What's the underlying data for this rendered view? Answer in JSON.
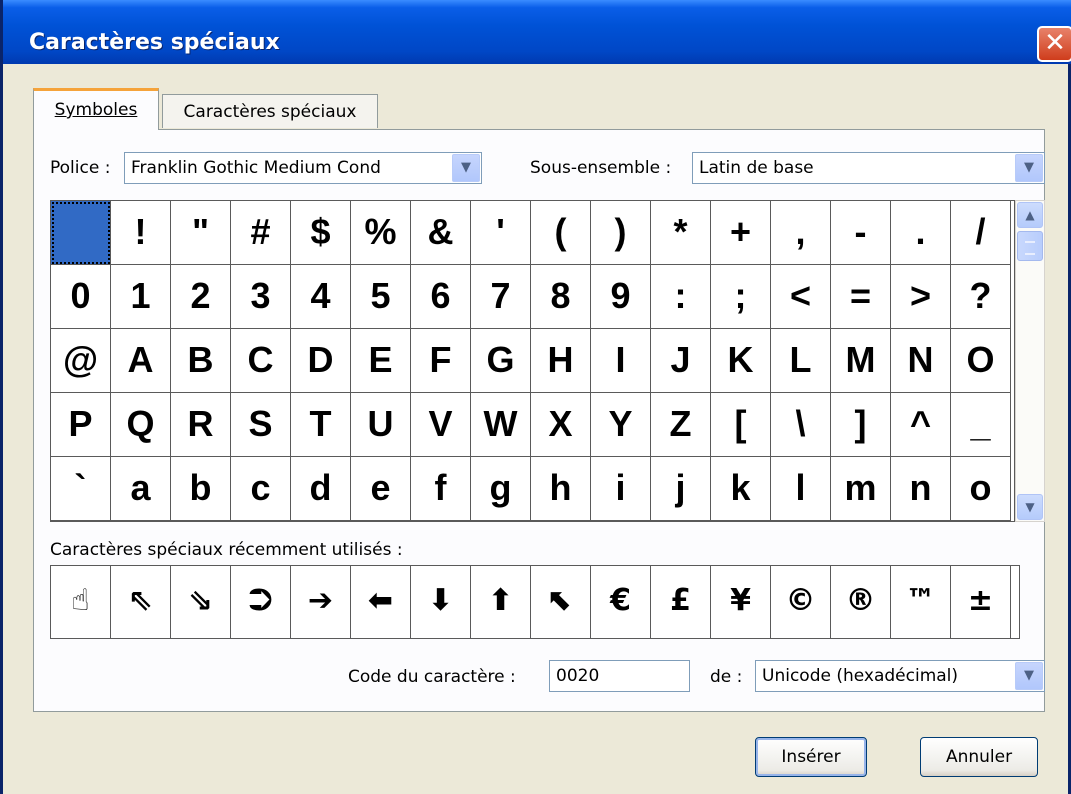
{
  "window": {
    "title": "Caractères spéciaux",
    "close_symbol": "✕"
  },
  "tabs": [
    {
      "label": "Symboles",
      "active": true
    },
    {
      "label": "Caractères spéciaux",
      "active": false
    }
  ],
  "font_label": "Police :",
  "font_value": "Franklin Gothic Medium Cond",
  "subset_label": "Sous-ensemble :",
  "subset_value": "Latin de base",
  "symbol_rows": [
    [
      " ",
      "!",
      "\"",
      "#",
      "$",
      "%",
      "&",
      "'",
      "(",
      ")",
      "*",
      "+",
      ",",
      "-",
      ".",
      "/"
    ],
    [
      "0",
      "1",
      "2",
      "3",
      "4",
      "5",
      "6",
      "7",
      "8",
      "9",
      ":",
      ";",
      "<",
      "=",
      ">",
      "?"
    ],
    [
      "@",
      "A",
      "B",
      "C",
      "D",
      "E",
      "F",
      "G",
      "H",
      "I",
      "J",
      "K",
      "L",
      "M",
      "N",
      "O"
    ],
    [
      "P",
      "Q",
      "R",
      "S",
      "T",
      "U",
      "V",
      "W",
      "X",
      "Y",
      "Z",
      "[",
      "\\",
      "]",
      "^",
      "_"
    ],
    [
      "`",
      "a",
      "b",
      "c",
      "d",
      "e",
      "f",
      "g",
      "h",
      "i",
      "j",
      "k",
      "l",
      "m",
      "n",
      "o"
    ]
  ],
  "selected_symbol": " ",
  "recent_label": "Caractères spéciaux récemment utilisés :",
  "recent_symbols": [
    "☝",
    "⇖",
    "⇘",
    "⮊",
    "➔",
    "⬅",
    "⬇",
    "⬆",
    "⬉",
    "€",
    "£",
    "¥",
    "©",
    "®",
    "™",
    "±"
  ],
  "char_code_label": "Code du caractère :",
  "char_code_value": "0020",
  "from_label": "de :",
  "from_value": "Unicode (hexadécimal)",
  "buttons": {
    "insert": "Insérer",
    "cancel": "Annuler"
  },
  "icons": {
    "dropdown": "chevron-down-icon",
    "scroll_up": "chevron-up-icon",
    "scroll_down": "chevron-down-icon"
  },
  "colors": {
    "titlebar": "#0052d6",
    "selection": "#316ac5",
    "active_tab_accent": "#f5a33a"
  }
}
